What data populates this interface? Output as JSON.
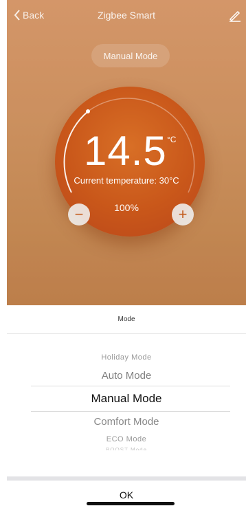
{
  "nav": {
    "back_label": "Back",
    "title": "Zigbee Smart",
    "edit_icon": "edit-icon"
  },
  "thermostat": {
    "mode_button": "Manual Mode",
    "temperature": "14.5",
    "unit": "°C",
    "current_temp_text": "Current temperature: 30°C",
    "percent": "100%",
    "minus_label": "−",
    "plus_label": "+"
  },
  "sheet": {
    "title": "Mode",
    "options": [
      "Holiday Mode",
      "Auto Mode",
      "Manual Mode",
      "Comfort Mode",
      "ECO Mode",
      "BOOST Mode"
    ],
    "selected": "Manual Mode",
    "ok_label": "OK"
  },
  "colors": {
    "accent": "#c9571a",
    "background": "#d99a66"
  }
}
